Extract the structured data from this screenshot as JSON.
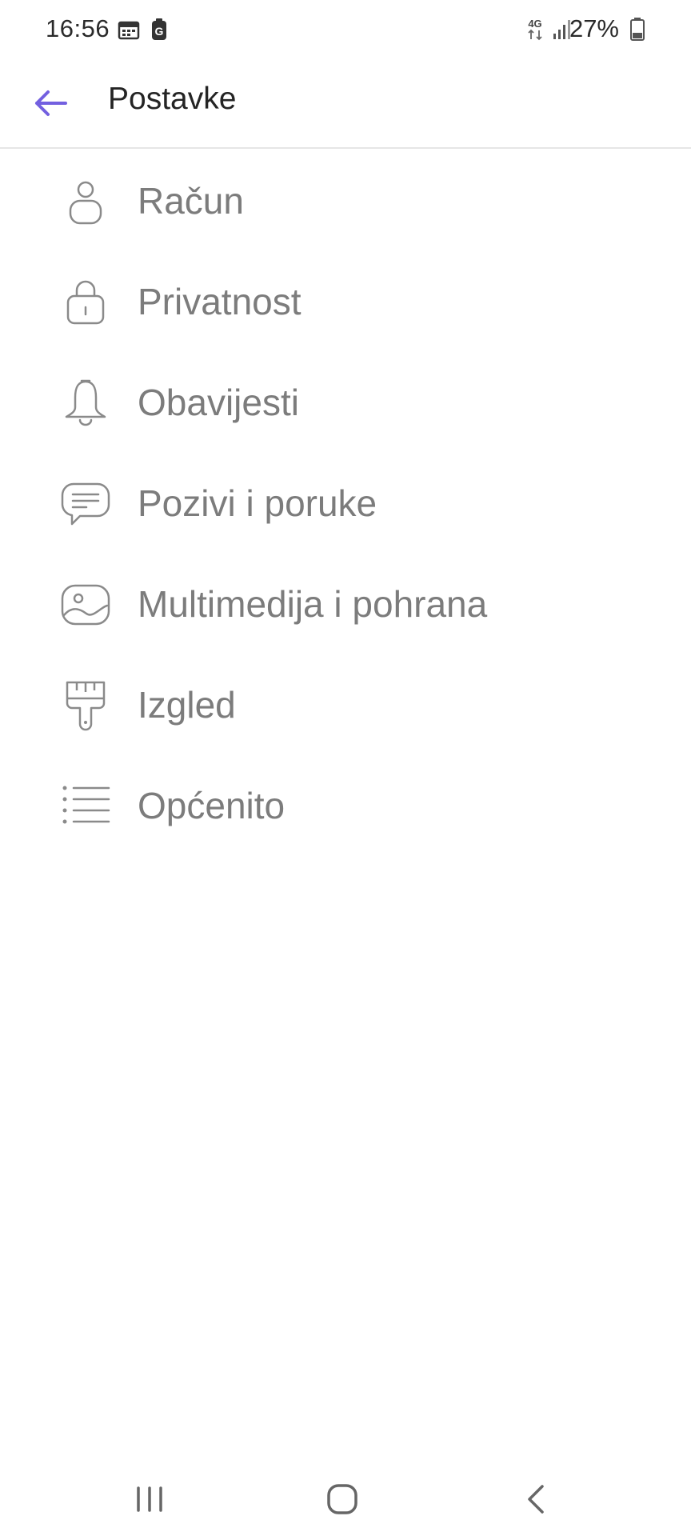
{
  "status_bar": {
    "time": "16:56",
    "network": "4G",
    "battery": "27%",
    "icons": [
      "calendar-icon",
      "g-app-icon",
      "network-4g-icon",
      "signal-icon",
      "battery-icon"
    ]
  },
  "app_bar": {
    "title": "Postavke",
    "back_icon": "arrow-left-icon",
    "accent_color": "#7360e0"
  },
  "settings": {
    "items": [
      {
        "label": "Račun",
        "icon": "account-icon"
      },
      {
        "label": "Privatnost",
        "icon": "lock-icon"
      },
      {
        "label": "Obavijesti",
        "icon": "bell-icon"
      },
      {
        "label": "Pozivi i poruke",
        "icon": "chat-icon"
      },
      {
        "label": "Multimedija i pohrana",
        "icon": "image-icon"
      },
      {
        "label": "Izgled",
        "icon": "brush-icon"
      },
      {
        "label": "Općenito",
        "icon": "list-icon"
      }
    ]
  },
  "nav_bar": {
    "buttons": [
      "recents-icon",
      "home-icon",
      "back-icon"
    ]
  },
  "colors": {
    "accent": "#7360e0",
    "label": "#7c7c7c",
    "icon_stroke": "#8a8a8a",
    "title": "#242424"
  }
}
